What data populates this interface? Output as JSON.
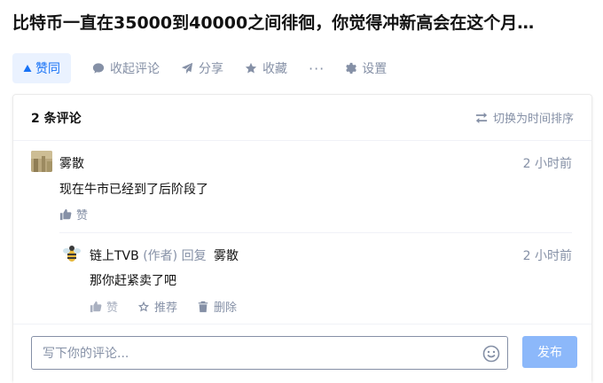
{
  "question": {
    "title": "比特币一直在35000到40000之间徘徊，你觉得冲新高会在这个月…"
  },
  "actions": {
    "vote_label": "赞同",
    "comment_label": "收起评论",
    "share_label": "分享",
    "favorite_label": "收藏",
    "more_label": "···",
    "settings_label": "设置"
  },
  "comments_panel": {
    "count_label": "2 条评论",
    "sort_label": "切换为时间排序",
    "comments": [
      {
        "author": "雾散",
        "time": "2 小时前",
        "content": "现在牛市已经到了后阶段了",
        "like_label": "赞"
      },
      {
        "author": "链上TVB",
        "role": "(作者)",
        "reply_label": "回复",
        "reply_to": "雾散",
        "time": "2 小时前",
        "content": "那你赶紧卖了吧",
        "like_label": "赞",
        "recommend_label": "推荐",
        "delete_label": "删除"
      }
    ]
  },
  "editor": {
    "placeholder": "写下你的评论...",
    "submit_label": "发布"
  },
  "colors": {
    "brand": "#1772f6",
    "brand_light_bg": "#eaf2ff",
    "muted": "#8590a6",
    "submit_disabled": "#8cb8fa"
  }
}
